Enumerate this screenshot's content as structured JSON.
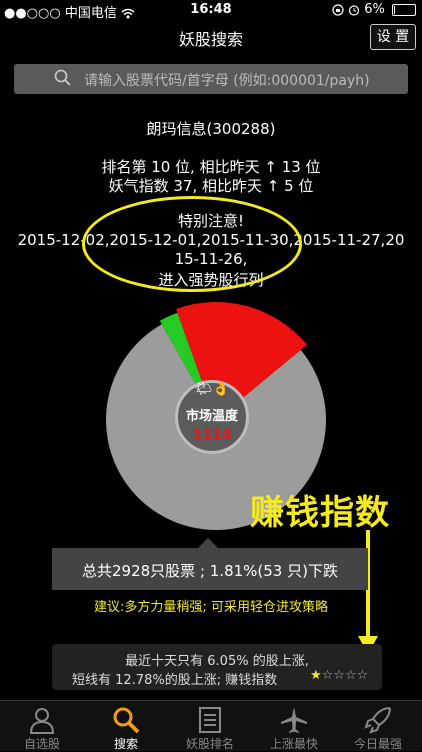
{
  "status_bar": {
    "signal": "●●○○○",
    "carrier": "中国电信",
    "time": "16:48",
    "battery": "6%",
    "battery_level": 0.06
  },
  "nav": {
    "title": "妖股搜索",
    "settings_label": "设 置"
  },
  "search": {
    "placeholder": "请输入股票代码/首字母 (例如:000001/payh)"
  },
  "stock": {
    "name": "朗玛信息(300288)",
    "rank_line": "排名第 10 位, 相比昨天 ↑ 13 位",
    "index_line": "妖气指数 37, 相比昨天 ↑ 5 位"
  },
  "notice": {
    "title": "特别注意!",
    "dates_line1": "2015-12-02,2015-12-01,2015-11-30,2015-11-27,20",
    "dates_line2": "15-11-26,",
    "result": "进入强势股行列"
  },
  "gauge": {
    "emoji": "🌤👌",
    "label": "市场温度",
    "value": "1114",
    "down_pct": 0.9819,
    "red_pct": 0.8,
    "colors": {
      "grey": "#9c9c9c",
      "red": "#ee1111",
      "green": "#22cc22"
    }
  },
  "annotation": {
    "earn_index": "赚钱指数",
    "color": "#f5ea1c"
  },
  "tooltip": {
    "text": "总共2928只股票 ; 1.81%(53 只)下跌"
  },
  "advice": {
    "text": "建议:多方力量稍强; 可采用轻仓进攻策略"
  },
  "summary": {
    "line1": "最近十天只有 6.05% 的股上涨,",
    "line2": "短线有 12.78%的股上涨; 赚钱指数",
    "stars_on": "★",
    "stars_off": "☆☆☆☆",
    "rating": 1,
    "rating_max": 5
  },
  "tabs": [
    {
      "label": "自选股",
      "icon": "person-icon",
      "active": false
    },
    {
      "label": "搜索",
      "icon": "search-icon",
      "active": true
    },
    {
      "label": "妖股排名",
      "icon": "list-icon",
      "active": false
    },
    {
      "label": "上涨最快",
      "icon": "airplane-icon",
      "active": false
    },
    {
      "label": "今日最强",
      "icon": "rocket-icon",
      "active": false
    }
  ]
}
